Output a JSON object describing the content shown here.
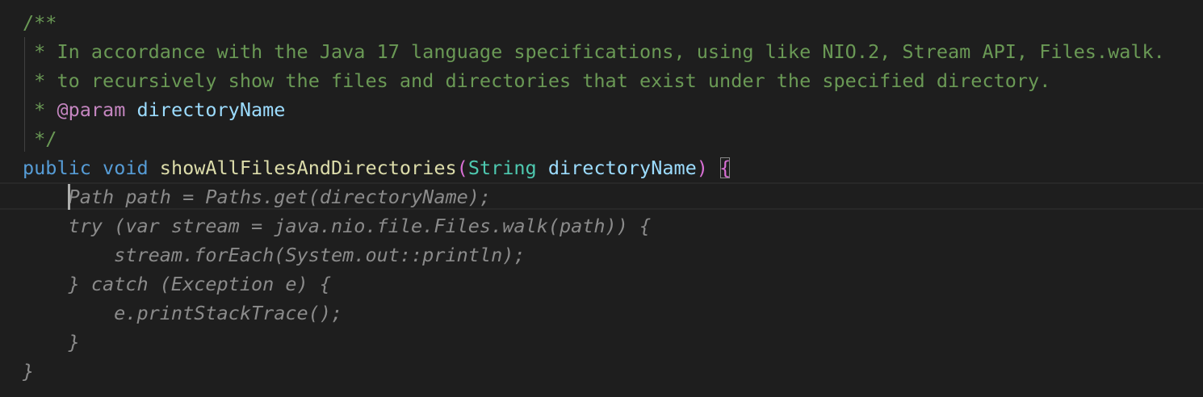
{
  "editor": {
    "lines": [
      {
        "tokens": [
          {
            "text": "/**",
            "kind": "comment"
          }
        ]
      },
      {
        "tokens": [
          {
            "text": " * In accordance with the Java 17 language specifications, using like NIO.2, Stream API, Files.walk.",
            "kind": "comment"
          }
        ]
      },
      {
        "tokens": [
          {
            "text": " * to recursively show the files and directories that exist under the specified directory.",
            "kind": "comment"
          }
        ]
      },
      {
        "tokens": [
          {
            "text": " * ",
            "kind": "comment"
          },
          {
            "text": "@param",
            "kind": "tag"
          },
          {
            "text": " ",
            "kind": "comment"
          },
          {
            "text": "directoryName",
            "kind": "var"
          }
        ]
      },
      {
        "tokens": [
          {
            "text": " */",
            "kind": "comment"
          }
        ]
      },
      {
        "tokens": [
          {
            "text": "public",
            "kind": "kw"
          },
          {
            "text": " ",
            "kind": "plain"
          },
          {
            "text": "void",
            "kind": "kw"
          },
          {
            "text": " ",
            "kind": "plain"
          },
          {
            "text": "showAllFilesAndDirectories",
            "kind": "fn"
          },
          {
            "text": "(",
            "kind": "paren"
          },
          {
            "text": "String",
            "kind": "type"
          },
          {
            "text": " ",
            "kind": "plain"
          },
          {
            "text": "directoryName",
            "kind": "var"
          },
          {
            "text": ")",
            "kind": "paren"
          },
          {
            "text": " ",
            "kind": "plain"
          },
          {
            "text": "{",
            "kind": "brace"
          }
        ]
      },
      {
        "tokens": [
          {
            "text": "    Path path = Paths.get(directoryName);",
            "kind": "ghost"
          }
        ]
      },
      {
        "tokens": [
          {
            "text": "    try (var stream = java.nio.file.Files.walk(path)) {",
            "kind": "ghost"
          }
        ]
      },
      {
        "tokens": [
          {
            "text": "        stream.forEach(System.out::println);",
            "kind": "ghost"
          }
        ]
      },
      {
        "tokens": [
          {
            "text": "    } catch (Exception e) {",
            "kind": "ghost"
          }
        ]
      },
      {
        "tokens": [
          {
            "text": "        e.printStackTrace();",
            "kind": "ghost"
          }
        ]
      },
      {
        "tokens": [
          {
            "text": "    }",
            "kind": "ghost"
          }
        ]
      },
      {
        "tokens": [
          {
            "text": "}",
            "kind": "ghost"
          }
        ]
      }
    ]
  }
}
